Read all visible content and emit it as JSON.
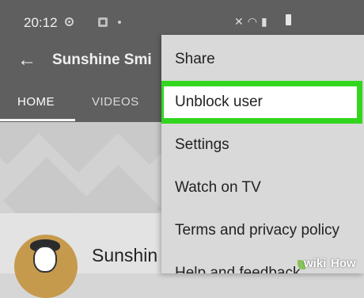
{
  "status_bar": {
    "time": "20:12",
    "icons": [
      "chrome-icon",
      "app-notification-icon",
      "notification-dot",
      "mute-icon",
      "wifi-icon",
      "signal-icon",
      "battery-icon"
    ]
  },
  "app_bar": {
    "title": "Sunshine Smi"
  },
  "tabs": [
    {
      "label": "HOME",
      "active": true
    },
    {
      "label": "VIDEOS",
      "active": false
    }
  ],
  "channel": {
    "name": "Sunshin"
  },
  "menu": {
    "items": [
      {
        "label": "Share",
        "highlighted": false
      },
      {
        "label": "Unblock user",
        "highlighted": true
      },
      {
        "label": "Settings",
        "highlighted": false
      },
      {
        "label": "Watch on TV",
        "highlighted": false
      },
      {
        "label": "Terms and privacy policy",
        "highlighted": false
      },
      {
        "label": "Help and feedback",
        "highlighted": false
      }
    ]
  },
  "watermark": {
    "wiki": "wiki",
    "how": "How"
  },
  "colors": {
    "header_bg": "#5f5f5f",
    "menu_bg": "#d9d9d9",
    "highlight_border": "#33d61f"
  }
}
